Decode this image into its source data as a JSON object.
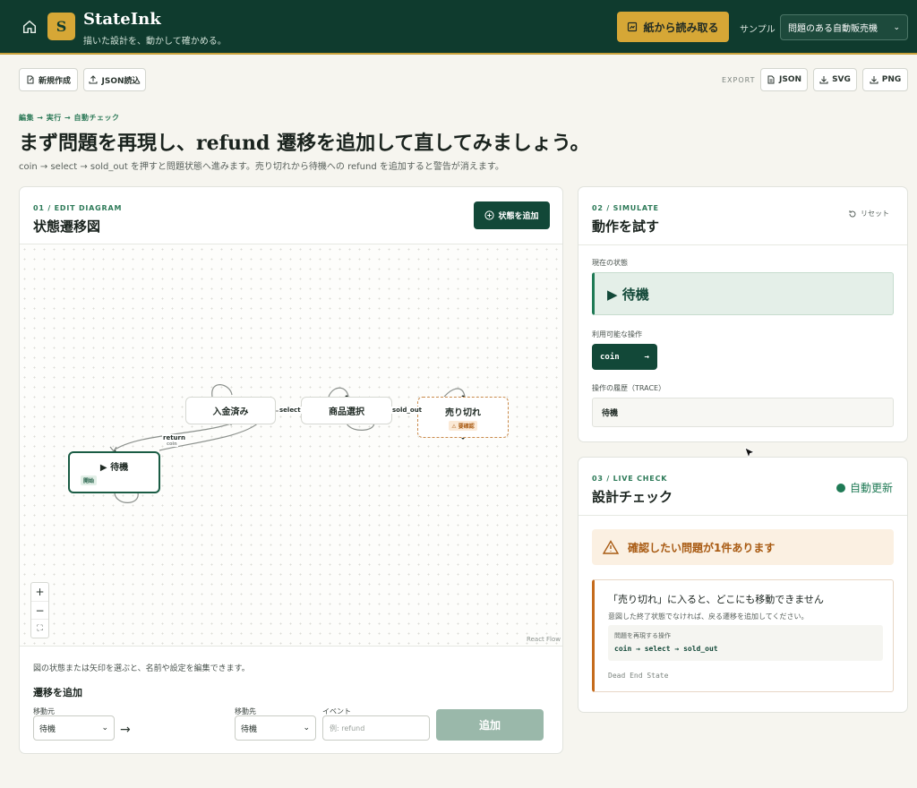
{
  "header": {
    "logo_letter": "S",
    "app_title": "StateInk",
    "app_subtitle": "描いた設計を、動かして確かめる。",
    "scan_button": "紙から読み取る",
    "sample_label": "サンプル",
    "sample_selected": "問題のある自動販売機"
  },
  "toolbar": {
    "new_label": "新規作成",
    "import_label": "JSON読込",
    "export_label": "EXPORT",
    "export_json": "JSON",
    "export_svg": "SVG",
    "export_png": "PNG"
  },
  "page": {
    "breadcrumb": "編集 → 実行 → 自動チェック",
    "title": "まず問題を再現し、refund 遷移を追加して直してみましょう。",
    "description": "coin → select → sold_out を押すと問題状態へ進みます。売り切れから待機への refund を追加すると警告が消えます。"
  },
  "diagram": {
    "kicker": "01 / EDIT DIAGRAM",
    "title": "状態遷移図",
    "add_state_button": "状態を追加",
    "nodes": {
      "idle": "▶ 待機",
      "idle_tag": "開始",
      "paid": "入金済み",
      "selected": "商品選択",
      "soldout": "売り切れ",
      "soldout_tag": "⚠ 要確認"
    },
    "edges": {
      "select": "select",
      "sold_out": "sold_out",
      "return": "return",
      "coin": "coin"
    },
    "zoom_in": "+",
    "zoom_out": "−",
    "fit": "⛶",
    "attribution": "React Flow",
    "hint": "図の状態または矢印を選ぶと、名前や設定を編集できます。",
    "add_transition_title": "遷移を追加",
    "from_label": "移動元",
    "from_value": "待機",
    "to_label": "移動先",
    "to_value": "待機",
    "event_label": "イベント",
    "event_placeholder": "例: refund",
    "add_button": "追加",
    "arrow": "→"
  },
  "simulate": {
    "kicker": "02 / SIMULATE",
    "title": "動作を試す",
    "reset": "リセット",
    "current_label": "現在の状態",
    "current_state": "▶ 待機",
    "actions_label": "利用可能な操作",
    "action_coin": "coin",
    "action_arrow": "→",
    "trace_label": "操作の履歴（TRACE）",
    "trace_value": "待機"
  },
  "check": {
    "kicker": "03 / LIVE CHECK",
    "title": "設計チェック",
    "auto_update": "自動更新",
    "warning": "確認したい問題が1件あります",
    "issue_title": "「売り切れ」に入ると、どこにも移動できません",
    "issue_desc": "意図した終了状態でなければ、戻る遷移を追加してください。",
    "repro_label": "問題を再現する操作",
    "repro_steps": "coin → select → sold_out",
    "issue_type": "Dead End State"
  },
  "colors": {
    "header_bg": "#0f3b2e",
    "accent_gold": "#d6a736",
    "primary": "#124838",
    "warning": "#c56b1c"
  }
}
